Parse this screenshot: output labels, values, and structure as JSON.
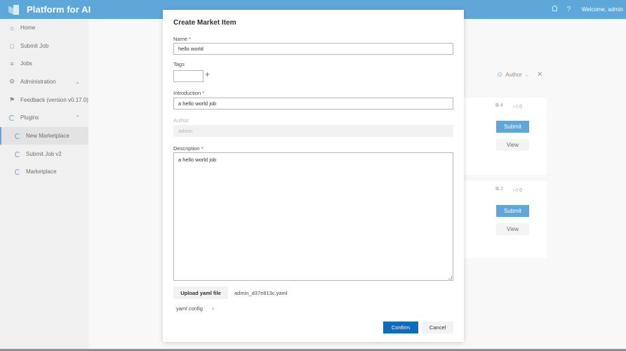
{
  "app": {
    "title": "Platform for AI"
  },
  "topbar": {
    "notifications_icon": "bell-icon",
    "help_icon": "?",
    "welcome": "Welcome, admin"
  },
  "sidebar": {
    "items": [
      {
        "label": "Home",
        "icon": "home-icon"
      },
      {
        "label": "Submit Job",
        "icon": "submit-job-icon"
      },
      {
        "label": "Jobs",
        "icon": "list-icon"
      },
      {
        "label": "Administration",
        "icon": "gear-icon",
        "expandable": true,
        "expanded": false
      },
      {
        "label": "Feedback (version v0.17.0)",
        "icon": "feedback-icon"
      },
      {
        "label": "Plugins",
        "icon": "plugin-icon",
        "expandable": true,
        "expanded": true
      },
      {
        "label": "New Marketplace",
        "icon": "plugin-icon",
        "active": true
      },
      {
        "label": "Submit Job v2",
        "icon": "plugin-icon"
      },
      {
        "label": "Marketplace",
        "icon": "plugin-icon"
      }
    ]
  },
  "background": {
    "filter": {
      "label": "Author"
    },
    "cards": [
      {
        "copies": "4",
        "likes": "0",
        "submit_label": "Submit",
        "view_label": "View"
      },
      {
        "copies": "2",
        "likes": "0",
        "submit_label": "Submit",
        "view_label": "View"
      }
    ]
  },
  "modal": {
    "title": "Create Market Item",
    "name": {
      "label": "Name",
      "required": "*",
      "value": "hello world"
    },
    "tags": {
      "label": "Tags",
      "value": "",
      "add_icon": "+"
    },
    "introduction": {
      "label": "Introduction",
      "required": "*",
      "value": "a hello world job"
    },
    "author": {
      "label": "Author",
      "value": "admin"
    },
    "description": {
      "label": "Description",
      "required": "*",
      "value": "a hello world job"
    },
    "upload_label": "Upload yaml file",
    "file_name": "admin_d37e813c.yaml",
    "yaml_config_label": "yaml config",
    "confirm_label": "Confirm",
    "cancel_label": "Cancel"
  },
  "colors": {
    "topbar": "#5ea7d8",
    "primary": "#0f6cbd",
    "card_submit": "#5ea7d8",
    "required": "#d13438"
  }
}
